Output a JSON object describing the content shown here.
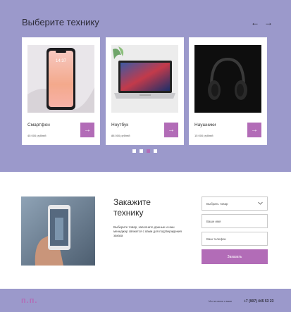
{
  "catalog": {
    "title": "Выберите технику",
    "prev_icon": "←",
    "next_icon": "→",
    "products": [
      {
        "name": "Смартфон",
        "price": "45 000 рублей",
        "icon": "arrow-right-icon"
      },
      {
        "name": "Ноутбук",
        "price": "88 000 рублей",
        "icon": "arrow-right-icon"
      },
      {
        "name": "Наушники",
        "price": "15 000 рублей",
        "icon": "arrow-right-icon"
      }
    ],
    "arrow": "→",
    "active_dot": 3
  },
  "order": {
    "title_line1": "Закажите",
    "title_line2": "технику",
    "description": "Выберите товар, заполните данные и наш менеджер свяжется с вами для подтверждения заказа",
    "select_label": "Выбрать товар",
    "name_placeholder": "Ваше имя",
    "phone_placeholder": "Ваш телефон",
    "submit": "Заказать"
  },
  "footer": {
    "logo": "п.п.",
    "contact_label": "Мы на связи с вами",
    "phone": "+7 (907) 445 53 23"
  },
  "colors": {
    "accent": "#b26cb7",
    "band": "#9b99cb"
  }
}
